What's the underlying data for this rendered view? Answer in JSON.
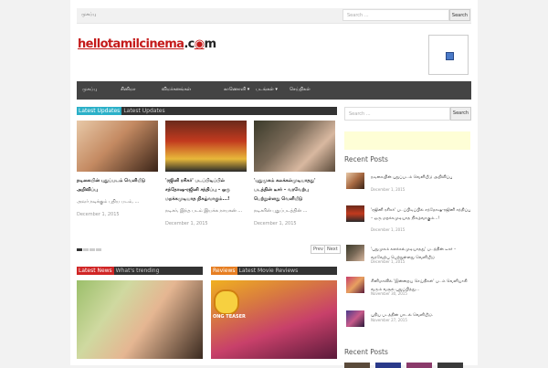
{
  "topbar": {
    "menu_label": "முகப்பு",
    "search_placeholder": "Search ...",
    "search_button": "Search"
  },
  "logo": {
    "part1": "hello",
    "part2": "tamilcinema",
    "part3": ".c",
    "part4": "m"
  },
  "nav": {
    "items": [
      "முகப்பு",
      "சினிமா",
      "விமர்சனங்கள்",
      "காணொளி ▾",
      "படங்கள் ▾",
      "செய்திகள்"
    ]
  },
  "latest": {
    "tab_active": "Latest Updates",
    "tab_inactive": "Latest Updates",
    "cards": [
      {
        "title": "நடிகையின் புதுப்படம் வெளியீடு அறிவிப்பு",
        "excerpt": "அவர் நடிக்கும் புதிய படம், ...",
        "date": "December 1, 2015"
      },
      {
        "title": "'ரஜினி ரசிகர்' படப்பிடிப்பில் சந்தோஷ-ரஜினி சந்திப்பு – ஒரு மறக்கமுடியாத நிகழ்வாகும்...!",
        "excerpt": "நடிகர், இந்த படம் இயக்க நாயகன் ...",
        "date": "December 1, 2015"
      },
      {
        "title": "'புதுமுகம் கலக்கல்முடியாதது' படத்தின் டீசர் – வரவேற்பு பெற்றுள்ளது வெளியீடு",
        "excerpt": "நடிகரின் புதுப்படத்தின் ...",
        "date": "December 1, 2015"
      }
    ],
    "prev": "Prev",
    "next": "Next"
  },
  "news_tabs": {
    "active": "Latest News",
    "inactive": "What's trending"
  },
  "reviews_tabs": {
    "active": "Reviews",
    "inactive": "Latest Movie Reviews"
  },
  "reviews_overlay": "ONG TEASER",
  "sidebar": {
    "search_placeholder": "Search ...",
    "search_button": "Search",
    "recent_heading": "Recent Posts",
    "recent_heading2": "Recent Posts",
    "posts": [
      {
        "title": "நடிகையின் புதுப்படம் வெளியீடு அறிவிப்பு",
        "date": "December 1, 2015"
      },
      {
        "title": "'ரஜினி ரசிகர்' படப்பிடிப்பில் சந்தோஷ-ரஜினி சந்திப்பு – ஒரு மறக்கமுடியாத நிகழ்வாகும்...!",
        "date": "December 1, 2015"
      },
      {
        "title": "'புதுமுகம் கலக்கல்முடியாதது' படத்தின் டீசர் – வரவேற்பு பெற்றுள்ளது வெளியீடு",
        "date": "December 1, 2015"
      },
      {
        "title": "சினிமாவில் 'இன்றைய செய்திகள்' படம் வெளியாகி வரும் வசூல் புதுப்பித்து...",
        "date": "November 30, 2015"
      },
      {
        "title": "புதிய படத்தின் பாடல் வெளியீடு.",
        "date": "November 27, 2015"
      }
    ]
  }
}
